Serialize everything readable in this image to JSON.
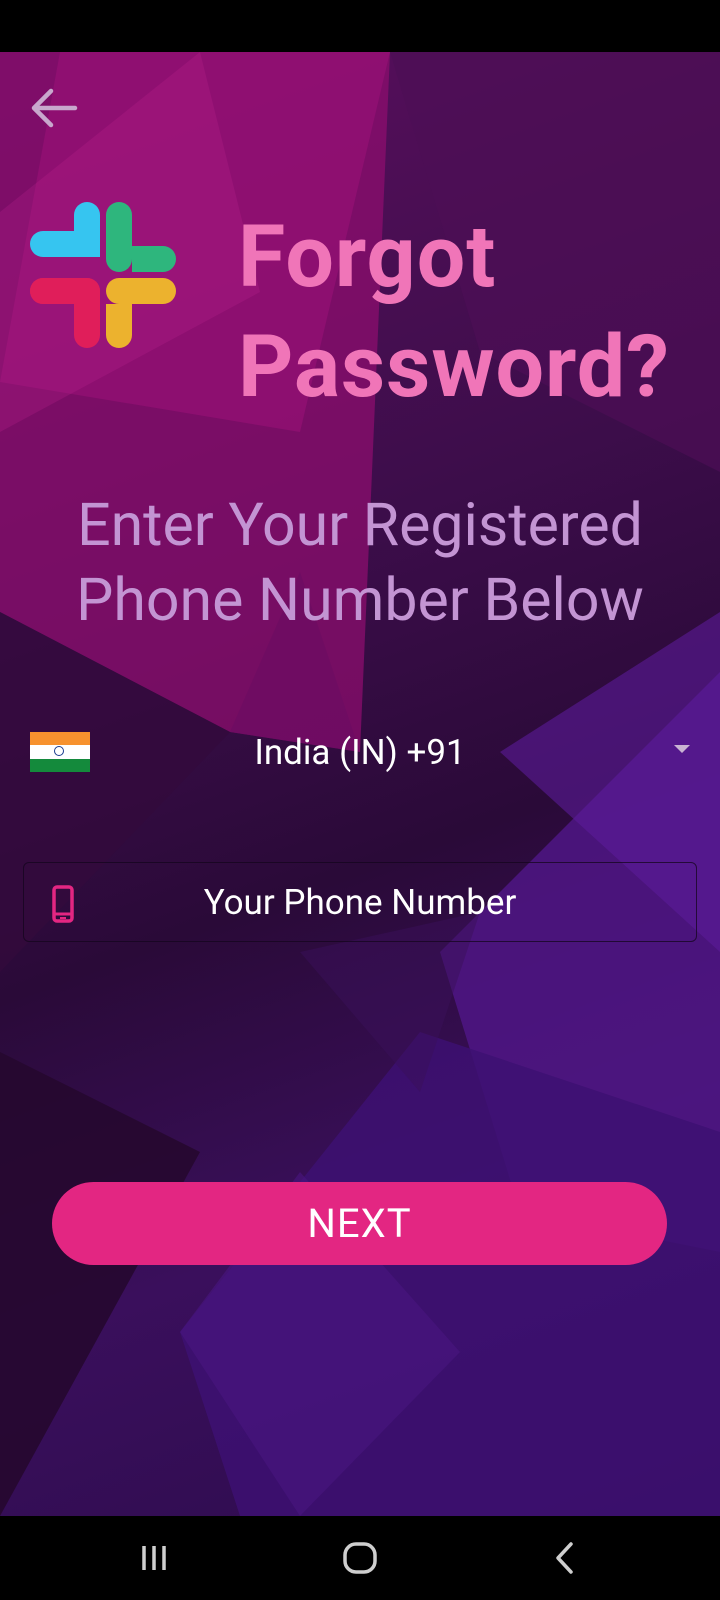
{
  "header": {
    "back_icon": "arrow-left-icon",
    "logo_icon": "slack-logo-icon",
    "title_line1": "Forgot",
    "title_line2": "Password?"
  },
  "instructions": {
    "line1": "Enter Your Registered",
    "line2": "Phone Number Below"
  },
  "country_picker": {
    "flag_icon": "india-flag-icon",
    "selected": "India (IN)  +91",
    "caret_icon": "caret-down-icon"
  },
  "phone_input": {
    "icon": "mobile-phone-icon",
    "value": "",
    "placeholder": "Your Phone Number"
  },
  "next_button": {
    "label": "NEXT"
  },
  "navigation_bar": {
    "recents_icon": "recents-icon",
    "home_icon": "home-icon",
    "back_icon": "back-icon"
  },
  "colors": {
    "title": "#f075b8",
    "subtitle": "#c394d3",
    "accent_button": "#e32682",
    "text": "#ffffff"
  }
}
